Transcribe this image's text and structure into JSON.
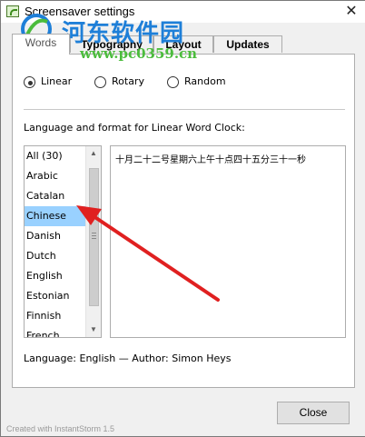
{
  "window": {
    "title": "Screensaver settings",
    "close_glyph": "✕"
  },
  "watermark": {
    "site_cn": "河东软件园",
    "url": "www.pc0359.cn",
    "logo_icon": "hedong-logo-icon"
  },
  "tabs": [
    {
      "label": "Words"
    },
    {
      "label": "Typography"
    },
    {
      "label": "Layout"
    },
    {
      "label": "Updates"
    }
  ],
  "modes": {
    "options": [
      {
        "label": "Linear",
        "selected": true
      },
      {
        "label": "Rotary",
        "selected": false
      },
      {
        "label": "Random",
        "selected": false
      }
    ]
  },
  "section_label": "Language and format for Linear Word Clock:",
  "languages": {
    "items": [
      "All (30)",
      "Arabic",
      "Catalan",
      "Chinese",
      "Danish",
      "Dutch",
      "English",
      "Estonian",
      "Finnish",
      "French"
    ],
    "selected": "Chinese",
    "scrollbar": {
      "up_glyph": "▲",
      "down_glyph": "▼"
    }
  },
  "preview_text": "十月二十二号星期六上午十点四十五分三十一秒",
  "footer_info": "Language: English — Author: Simon Heys",
  "buttons": {
    "close": "Close"
  },
  "credit": "Created with InstantStorm 1.5",
  "colors": {
    "selection": "#99d1ff",
    "annotation_arrow": "#e02020",
    "watermark_blue": "#1e7fd8",
    "watermark_green": "#4bbc3c"
  }
}
